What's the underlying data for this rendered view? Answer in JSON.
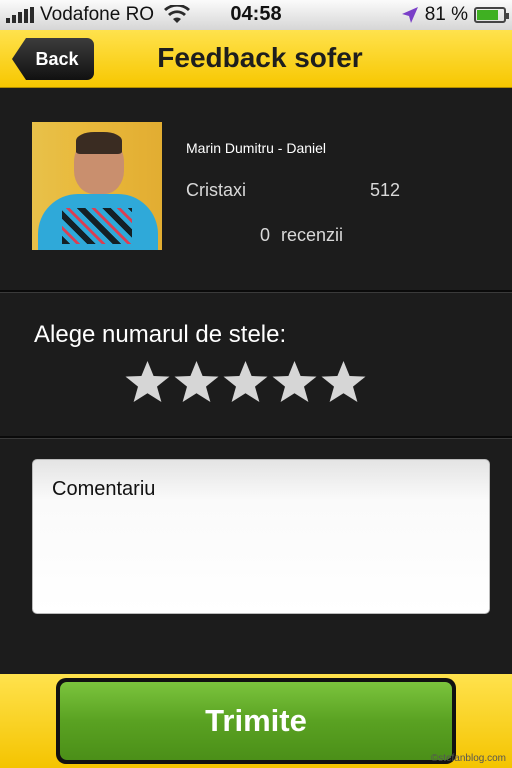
{
  "status_bar": {
    "carrier": "Vodafone RO",
    "time": "04:58",
    "battery_text": "81 %",
    "battery_level": 0.81,
    "icons": [
      "signal-icon",
      "wifi-icon",
      "location-icon",
      "battery-icon"
    ]
  },
  "nav": {
    "back_label": "Back",
    "title": "Feedback sofer"
  },
  "driver": {
    "name": "Marin Dumitru - Daniel",
    "company": "Cristaxi",
    "id": "512",
    "review_count": "0",
    "review_label": "recenzii"
  },
  "rating": {
    "label": "Alege numarul de stele:",
    "max_stars": 5,
    "selected": 0,
    "star_color": "#d6d6d6"
  },
  "comment": {
    "placeholder": "Comentariu"
  },
  "submit": {
    "label": "Trimite"
  },
  "watermark": "©stefanblog.com",
  "colors": {
    "accent_yellow": "#f7c700",
    "button_green": "#5aa222",
    "background": "#1c1c1c"
  }
}
